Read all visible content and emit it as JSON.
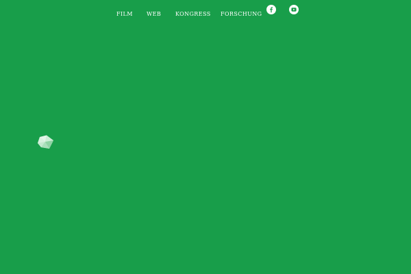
{
  "nav": {
    "items": [
      {
        "label": "FILM"
      },
      {
        "label": "WEB"
      },
      {
        "label": "KONGRESS"
      },
      {
        "label": "FORSCHUNG"
      }
    ]
  },
  "social": {
    "facebook_icon": "facebook-icon",
    "youtube_icon": "youtube-icon"
  },
  "logo": {
    "icon": "polygon-logo-icon"
  },
  "colors": {
    "background": "#189e4a",
    "nav_text": "#ffffff",
    "icon_fill": "#ffffff",
    "icon_glyph": "#189e4a"
  }
}
